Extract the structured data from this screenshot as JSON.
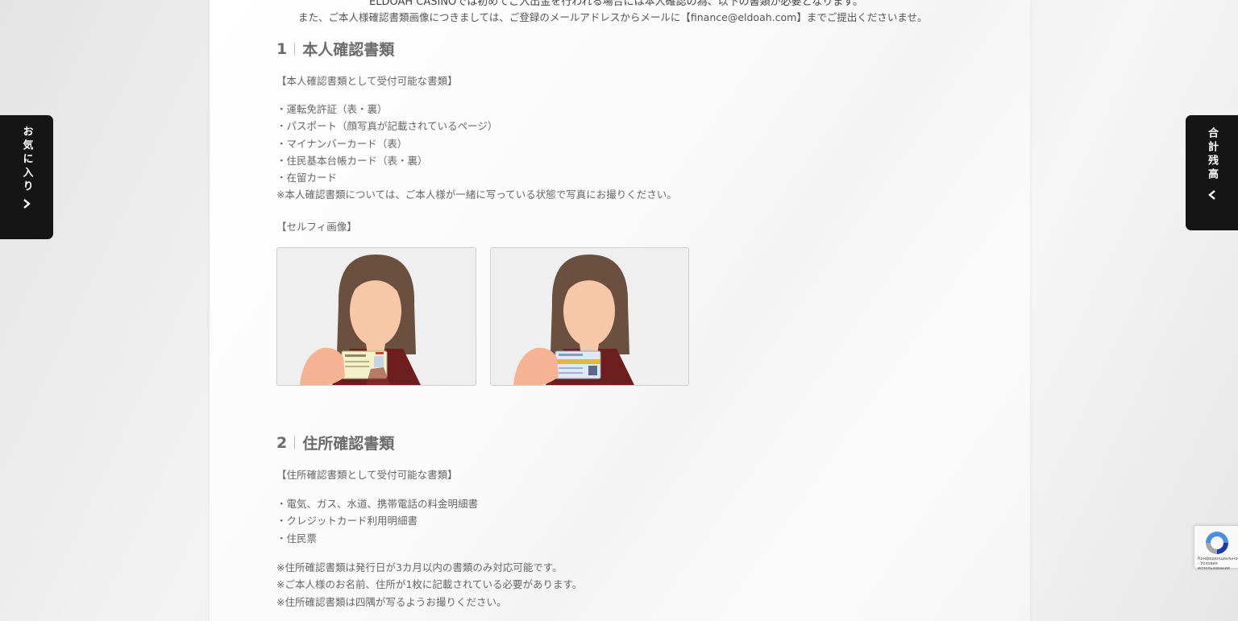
{
  "content": {
    "cutoff_text": "ELDOAH CASINOでは初めてご入出金を行われる場合には本人確認の為、以下の書類が必要となります。",
    "intro_text": "また、ご本人様確認書類画像につきましては、ご登録のメールアドレスからメールに【finance@eldoah.com】までご提出くださいませ。",
    "section1": {
      "number": "1",
      "title": "本人確認書類",
      "subtitle": "【本人確認書類として受付可能な書類】",
      "items": [
        "・運転免許証（表・裏）",
        "・パスポート（顔写真が記載されているページ）",
        "・マイナンバーカード（表）",
        "・住民基本台帳カード（表・裏）",
        "・在留カード"
      ],
      "note": "※本人確認書類については、ご本人様が一緒に写っている状態で写真にお撮りください。",
      "selfie_label": "【セルフィ画像】"
    },
    "section2": {
      "number": "2",
      "title": "住所確認書類",
      "subtitle": "【住所確認書類として受付可能な書類】",
      "items": [
        "・電気、ガス、水道、携帯電話の料金明細書",
        "・クレジットカード利用明細書",
        "・住民票"
      ],
      "notes": [
        "※住所確認書類は発行日が3カ月以内の書類のみ対応可能です。",
        "※ご本人様のお名前、住所が1枚に記載されている必要があります。",
        "※住所確認書類は四隅が写るようお撮りください。"
      ]
    }
  },
  "side_tabs": {
    "favorites_label": "お気に入り",
    "favorites_icon": "chevron-right-icon",
    "balance_label": "合計残高",
    "balance_icon": "chevron-left-icon"
  },
  "recaptcha": {
    "text": "Конфиденциальность - Условия использования"
  },
  "colors": {
    "tab_background": "#151515",
    "hair": "#6b4f3f",
    "face": "#f7c7a8",
    "jacket": "#6e1e1e"
  }
}
